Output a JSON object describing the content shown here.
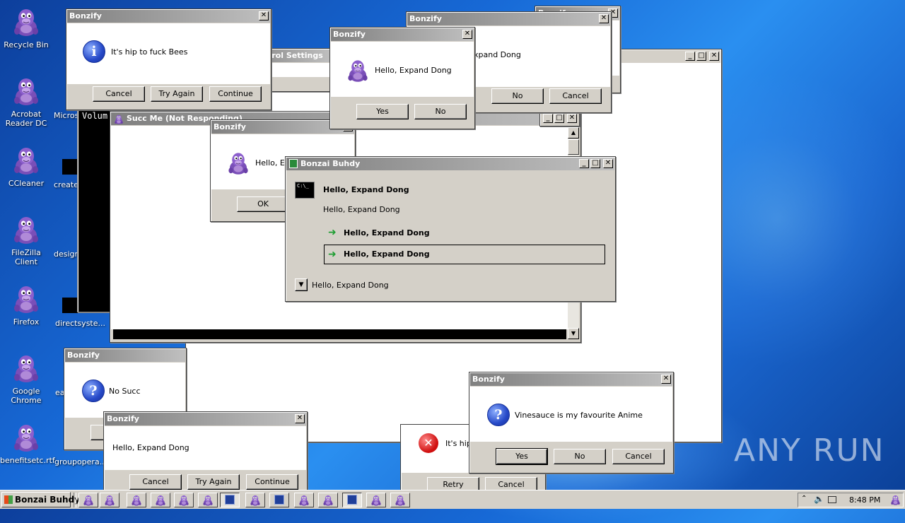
{
  "desktop": {
    "icons": [
      {
        "label": "Recycle Bin"
      },
      {
        "label": "Acrobat Reader DC"
      },
      {
        "label": "CCleaner"
      },
      {
        "label": "FileZilla Client"
      },
      {
        "label": "Firefox"
      },
      {
        "label": "Google Chrome"
      },
      {
        "label": "benefitsetc.rtf"
      }
    ],
    "partial_labels": [
      "Microso",
      "created",
      "design",
      "directsyste...",
      "ea",
      "groupopera..."
    ]
  },
  "windows": {
    "big_white": {
      "title": ""
    },
    "control_settings": {
      "title": "trol Settings"
    },
    "console": {
      "text": "Volum"
    },
    "succ_me": {
      "title": "Succ Me (Not Responding)"
    },
    "bonzify_topleft": {
      "title": "Bonzify",
      "message": "It's hip to fuck Bees",
      "buttons": [
        "Cancel",
        "Try Again",
        "Continue"
      ]
    },
    "bonzify_top_center": {
      "title": "Bonzify",
      "message": "Hello, Expand Dong",
      "buttons": [
        "Yes",
        "No"
      ]
    },
    "bonzify_top_right_back": {
      "title": "Bonzify"
    },
    "bonzify_top_right": {
      "title": "Bonzify",
      "message": "xpand Dong",
      "buttons": [
        "No",
        "Cancel"
      ]
    },
    "bonzify_mid": {
      "title": "Bonzify",
      "message": "Hello, Ex",
      "buttons": [
        "OK"
      ]
    },
    "bonzai_buhdy": {
      "title": "Bonzai Buhdy",
      "heading": "Hello, Expand Dong",
      "subtext": "Hello, Expand Dong",
      "options": [
        "Hello, Expand Dong",
        "Hello, Expand Dong"
      ],
      "details": "Hello, Expand Dong",
      "cmd_icon_text": "C:\\_"
    },
    "bonzify_nosucc": {
      "title": "Bonzify",
      "message": "No Succ"
    },
    "bonzify_bottom_left": {
      "title": "Bonzify",
      "message": "Hello, Expand Dong",
      "buttons": [
        "Cancel",
        "Try Again",
        "Continue"
      ]
    },
    "bonzify_bottom_back": {
      "message": "It's hip",
      "buttons": [
        "Retry",
        "Cancel"
      ]
    },
    "bonzify_vinesauce": {
      "title": "Bonzify",
      "message": "Vinesauce is my favourite Anime",
      "buttons": [
        "Yes",
        "No",
        "Cancel"
      ]
    }
  },
  "taskbar": {
    "start_label": "Bonzai Buhdy",
    "clock": "8:48 PM"
  },
  "watermark": "ANY RUN"
}
